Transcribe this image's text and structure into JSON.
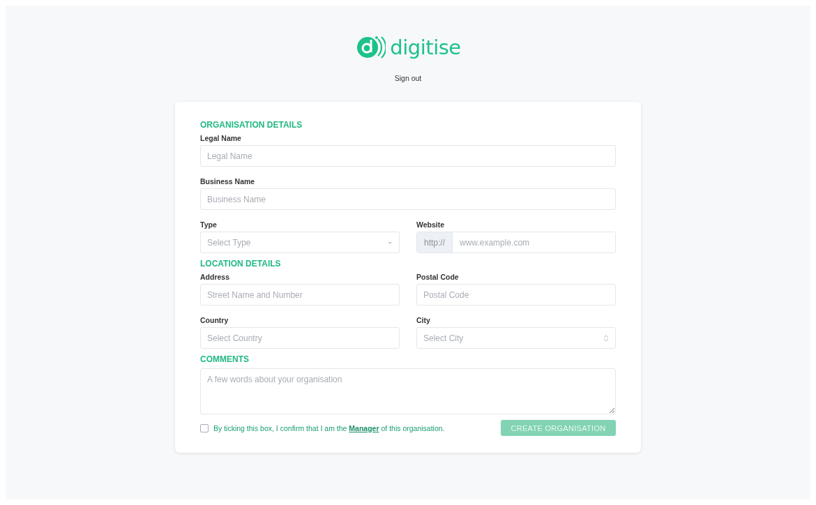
{
  "brand": {
    "name": "digitise"
  },
  "sign_out": "Sign out",
  "sections": [
    {
      "title": "ORGANISATION DETAILS",
      "rows": [
        [
          {
            "kind": "text",
            "label": "Legal Name",
            "placeholder": "Legal Name"
          }
        ],
        [
          {
            "kind": "text",
            "label": "Business Name",
            "placeholder": "Business Name"
          }
        ],
        [
          {
            "kind": "select",
            "label": "Type",
            "placeholder": "Select Type"
          },
          {
            "kind": "url",
            "label": "Website",
            "prefix": "http://",
            "placeholder": "www.example.com"
          }
        ]
      ]
    },
    {
      "title": "LOCATION DETAILS",
      "rows": [
        [
          {
            "kind": "text",
            "label": "Address",
            "placeholder": "Street Name and Number"
          },
          {
            "kind": "text",
            "label": "Postal Code",
            "placeholder": "Postal Code"
          }
        ],
        [
          {
            "kind": "text",
            "label": "Country",
            "placeholder": "Select Country"
          },
          {
            "kind": "stepper-select",
            "label": "City",
            "placeholder": "Select City"
          }
        ]
      ]
    },
    {
      "title": "COMMENTS",
      "rows": [
        [
          {
            "kind": "textarea",
            "placeholder": "A few words about your organisation"
          }
        ]
      ]
    }
  ],
  "consent": {
    "checked": false,
    "text_before": "By ticking this box, I confirm that I am the",
    "link": "Manager",
    "text_after": "of this organisation."
  },
  "submit": {
    "label": "CREATE ORGANISATION",
    "disabled": true
  }
}
